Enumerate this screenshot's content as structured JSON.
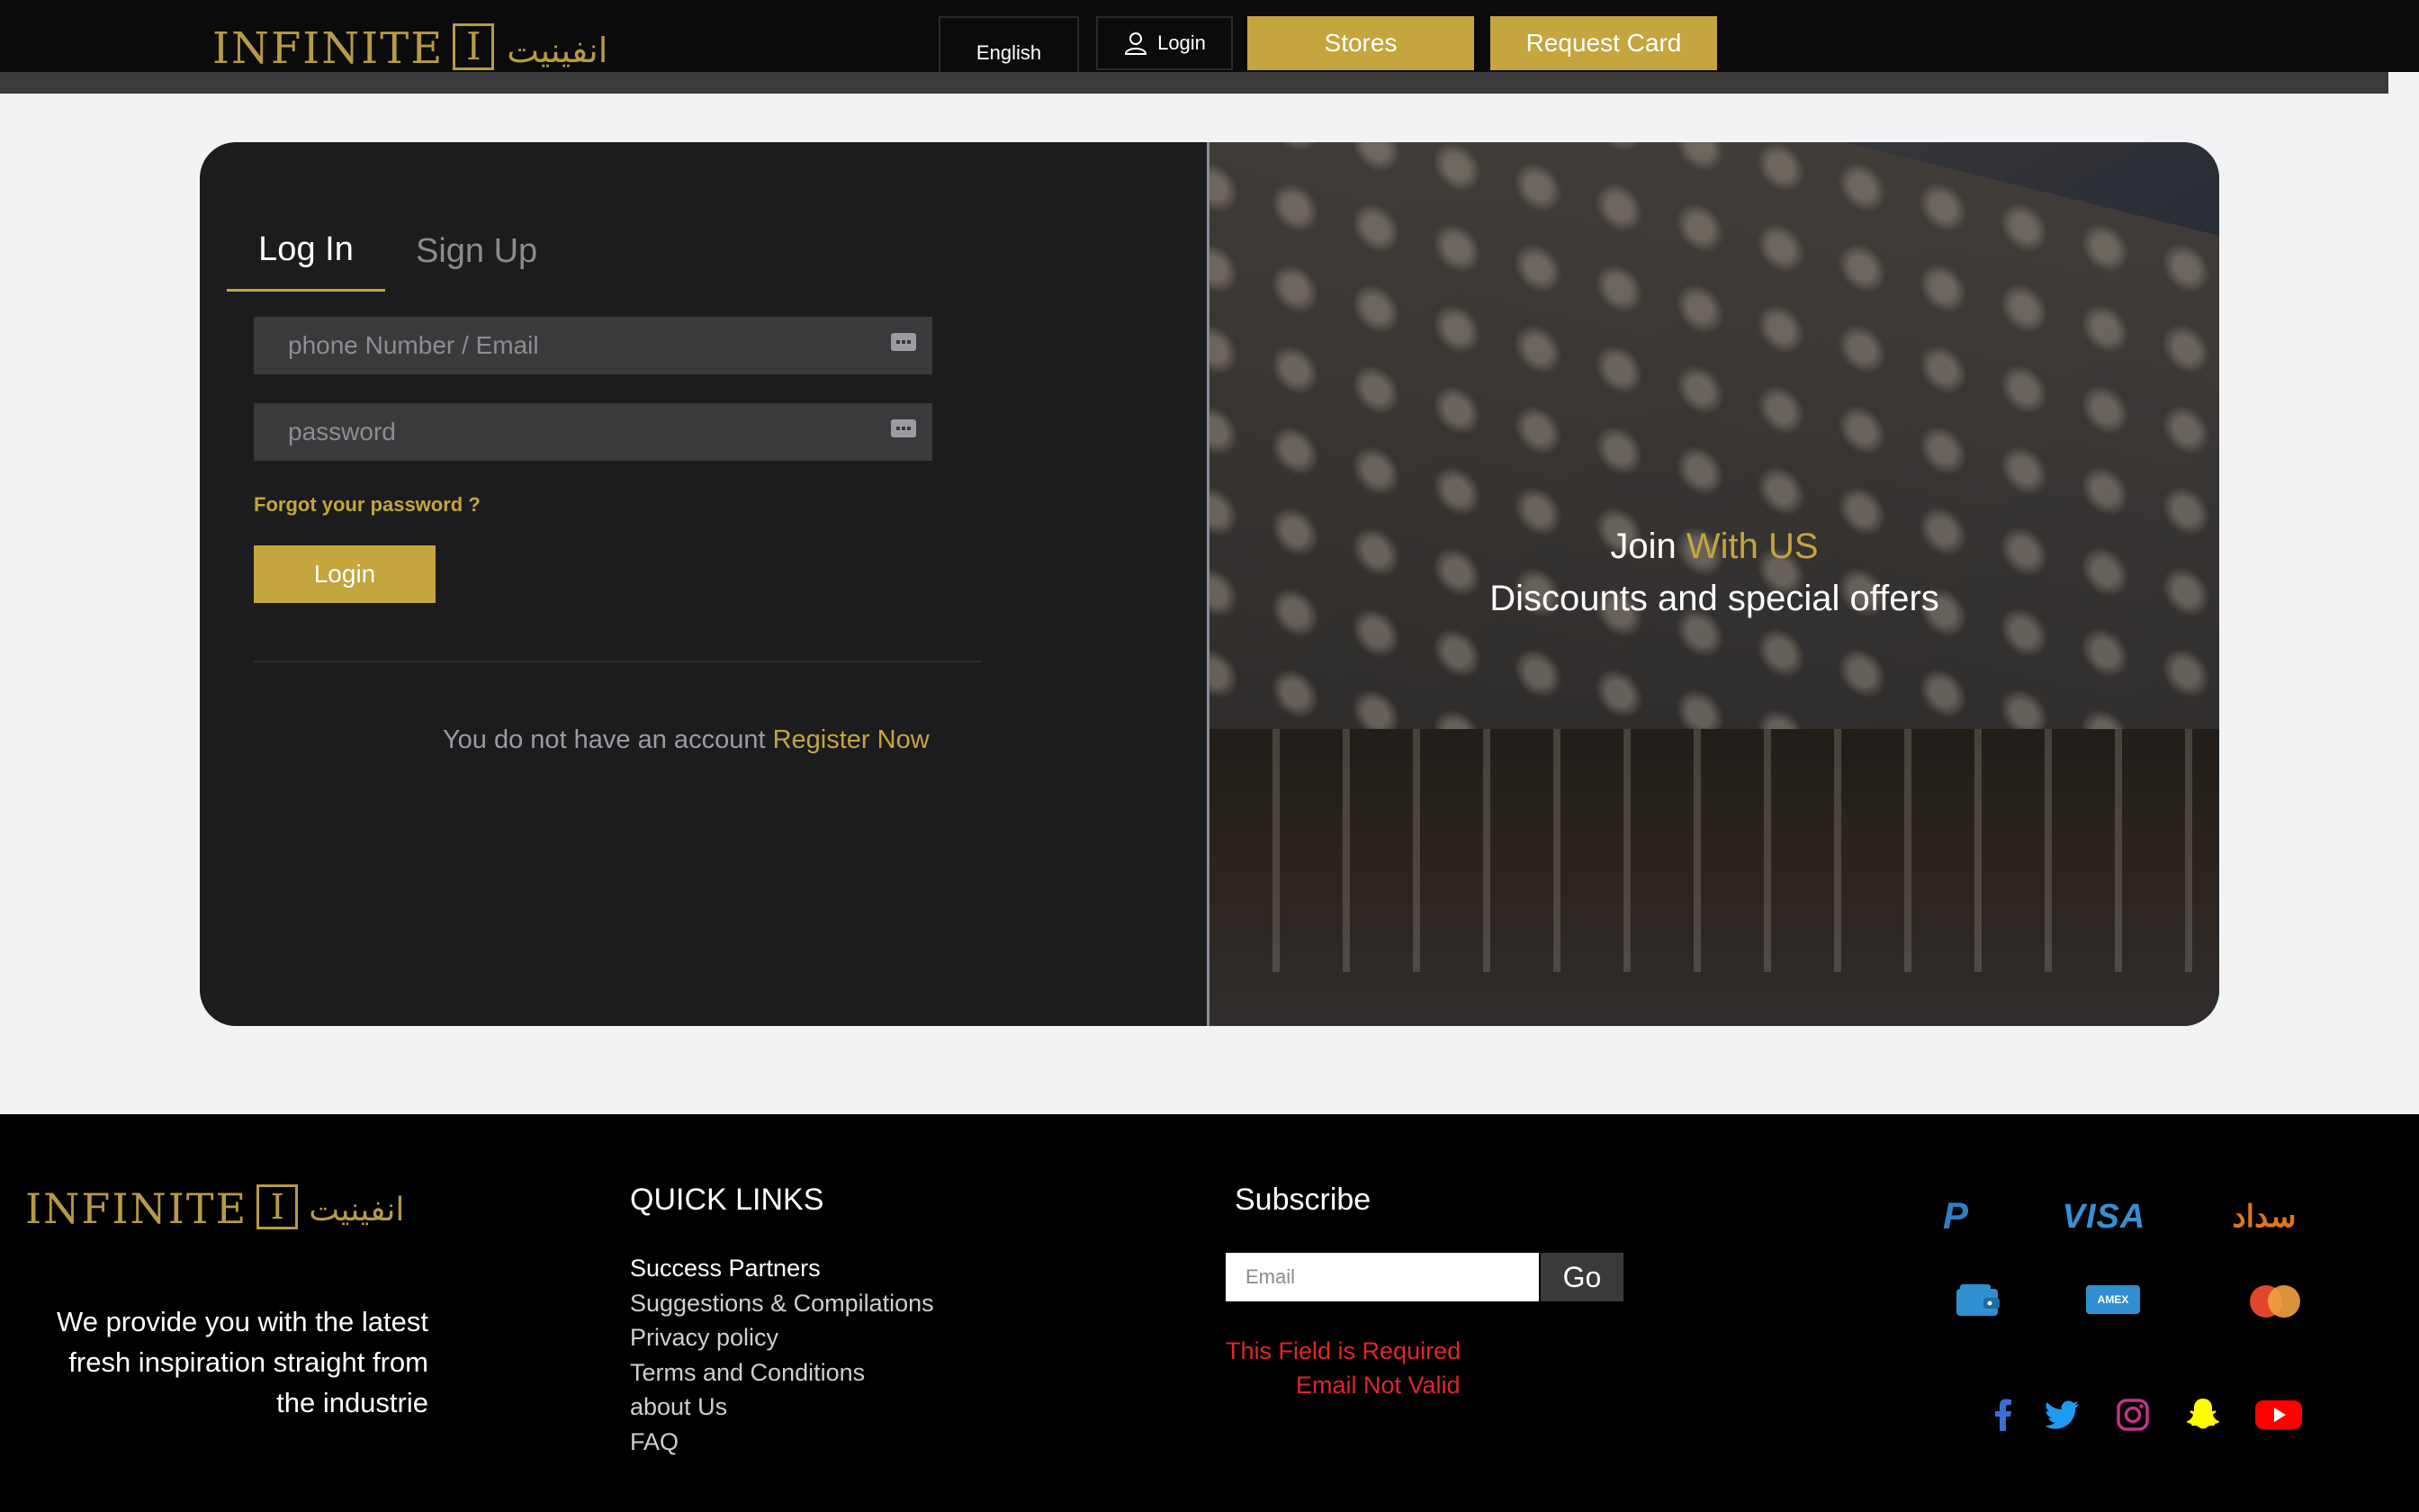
{
  "header": {
    "logo": {
      "wordmark": "INFINITE",
      "mark": "I",
      "arabic": "انفينيت"
    },
    "language_label": "English",
    "login_label": "Login",
    "stores_label": "Stores",
    "request_card_label": "Request Card"
  },
  "auth": {
    "tabs": [
      "Log In",
      "Sign Up"
    ],
    "active_tab": "Log In",
    "email_placeholder": "phone Number / Email",
    "password_placeholder": "password",
    "forgot_label": "Forgot your password ?",
    "submit_label": "Login",
    "no_account_text": "You do not have an account",
    "register_label": "Register Now"
  },
  "promo": {
    "join": "Join",
    "with_us": "With US",
    "subtitle": "Discounts and special offers"
  },
  "footer": {
    "logo": {
      "wordmark": "INFINITE",
      "mark": "I",
      "arabic": "انفينيت"
    },
    "tagline": "We provide you with the latest fresh inspiration straight from the industrie",
    "quick_links_title": "QUICK LINKS",
    "quick_links": [
      "Success Partners",
      "Suggestions & Compilations",
      "Privacy policy",
      "Terms and Conditions",
      "about Us",
      "FAQ"
    ],
    "subscribe_title": "Subscribe",
    "email_placeholder": "Email",
    "go_label": "Go",
    "errors": [
      "This Field is Required",
      "Email Not Valid"
    ],
    "payment_icons": [
      "paypal-icon",
      "visa-icon",
      "sadad-icon",
      "wallet-icon",
      "amex-icon",
      "mastercard-icon"
    ],
    "payment_labels": {
      "paypal": "P",
      "visa": "VISA",
      "sadad": "سداد",
      "amex": "AMEX"
    },
    "social_icons": [
      "facebook-icon",
      "twitter-icon",
      "instagram-icon",
      "snapchat-icon",
      "youtube-icon"
    ]
  },
  "colors": {
    "gold": "#c4a53e",
    "header_bg": "#0b0b0c",
    "panel_bg": "#1c1c1e",
    "error": "#e0262c"
  }
}
